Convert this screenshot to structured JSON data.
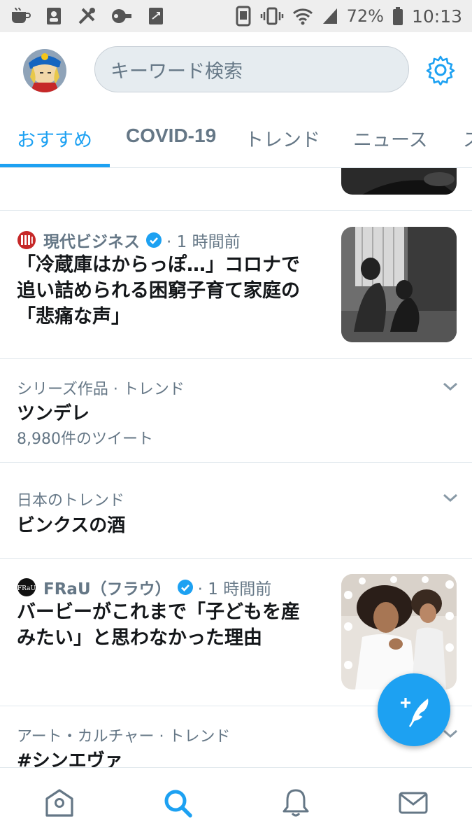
{
  "status_bar": {
    "battery": "72%",
    "time": "10:13"
  },
  "header": {
    "search_placeholder": "キーワード検索"
  },
  "tabs": [
    {
      "label": "おすすめ",
      "active": true
    },
    {
      "label": "COVID-19",
      "active": false
    },
    {
      "label": "トレンド",
      "active": false
    },
    {
      "label": "ニュース",
      "active": false
    },
    {
      "label": "ス",
      "active": false
    }
  ],
  "feed": {
    "news1": {
      "source": "現代ビジネス",
      "time": "· 1 時間前",
      "headline_lines": [
        "「冷蔵庫はからっぽ…」コロナで",
        "追い詰められる困窮子育て家庭の",
        "「悲痛な声」"
      ]
    },
    "trend1": {
      "category": "シリーズ作品 · トレンド",
      "title": "ツンデレ",
      "count": "8,980件のツイート"
    },
    "trend2": {
      "category": "日本のトレンド",
      "title": "ビンクスの酒"
    },
    "news2": {
      "source": "FRaU（フラウ）",
      "source_logo_text": "FRaU",
      "time": "· 1 時間前",
      "headline_lines": [
        "バービーがこれまで「子どもを産",
        "みたい」と思わなかった理由"
      ]
    },
    "trend3": {
      "category": "アート・カルチャー · トレンド",
      "title": "#シンエヴァ"
    }
  },
  "colors": {
    "accent": "#1da1f2",
    "secondary_text": "#657786",
    "primary_text": "#14171a",
    "divider": "#e1e8ed"
  },
  "icons": {
    "bottom_nav": [
      "home-icon",
      "search-icon",
      "notifications-icon",
      "messages-icon"
    ],
    "fab": "compose-tweet-icon"
  }
}
